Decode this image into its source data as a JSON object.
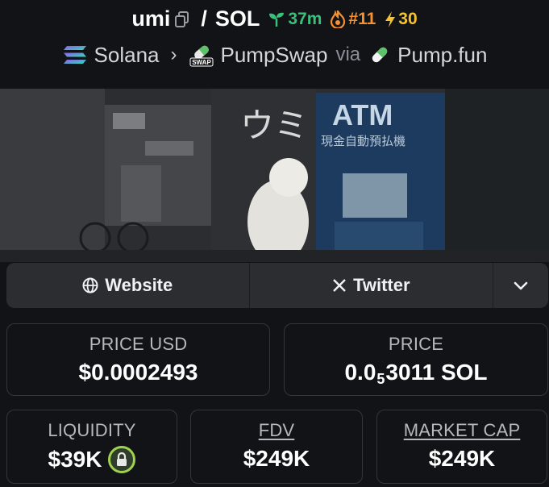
{
  "header": {
    "token": "umi",
    "separator": "/",
    "quote": "SOL",
    "age": "37m",
    "rank": "#11",
    "boosts": "30",
    "chain": "Solana",
    "dex": "PumpSwap",
    "dex_badge": "SWAP",
    "via": "via",
    "launchpad": "Pump.fun"
  },
  "banner": {
    "sign_text": "ウミ",
    "atm_text": "ATM",
    "atm_subtext": "現金自動預払機"
  },
  "links": {
    "website": "Website",
    "twitter": "Twitter"
  },
  "stats": {
    "price_usd_label": "PRICE USD",
    "price_usd": "$0.0002493",
    "price_label": "PRICE",
    "price_prefix": "0.0",
    "price_zeros": "5",
    "price_suffix": "3011 SOL",
    "liquidity_label": "LIQUIDITY",
    "liquidity": "$39K",
    "fdv_label": "FDV",
    "fdv": "$249K",
    "mcap_label": "MARKET CAP",
    "mcap": "$249K"
  },
  "colors": {
    "background": "#121316",
    "age": "#39c079",
    "rank": "#f6912f",
    "boost": "#f6c32f",
    "lock": "#9fd24e"
  }
}
